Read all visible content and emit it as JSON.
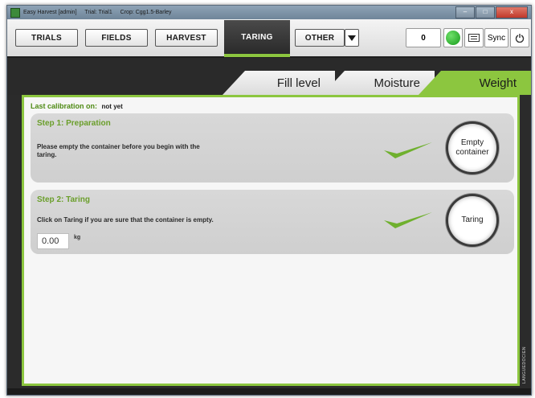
{
  "window": {
    "title_parts": [
      "Easy Harvest [admin]",
      "Trial: Trial1",
      "Crop: Cgg1.5-Barley"
    ],
    "controls": {
      "minimize": "–",
      "maximize": "□",
      "close": "x"
    }
  },
  "nav": {
    "items": [
      {
        "label": "TRIALS",
        "active": false
      },
      {
        "label": "FIELDS",
        "active": false
      },
      {
        "label": "HARVEST",
        "active": false
      },
      {
        "label": "TARING",
        "active": true
      },
      {
        "label": "OTHER",
        "active": false
      }
    ],
    "counter": "0",
    "status_color": "#1fb53a",
    "sync_label": "Sync",
    "accent": "#8cc63f"
  },
  "tabs": [
    {
      "label": "Fill level",
      "active": false
    },
    {
      "label": "Moisture",
      "active": false
    },
    {
      "label": "Weight",
      "active": true
    }
  ],
  "calibration": {
    "label": "Last calibration on:",
    "value": "not yet"
  },
  "step1": {
    "title": "Step 1: Preparation",
    "text_line1": "Please empty the container before you begin with the",
    "text_line2": "taring.",
    "button_line1": "Empty",
    "button_line2": "container"
  },
  "step2": {
    "title": "Step 2: Taring",
    "text": "Click on Taring if you are sure that the container is empty.",
    "weight_value": "0.00",
    "unit": "kg",
    "button_label": "Taring"
  },
  "brand": "LANGUEDOCIEN"
}
